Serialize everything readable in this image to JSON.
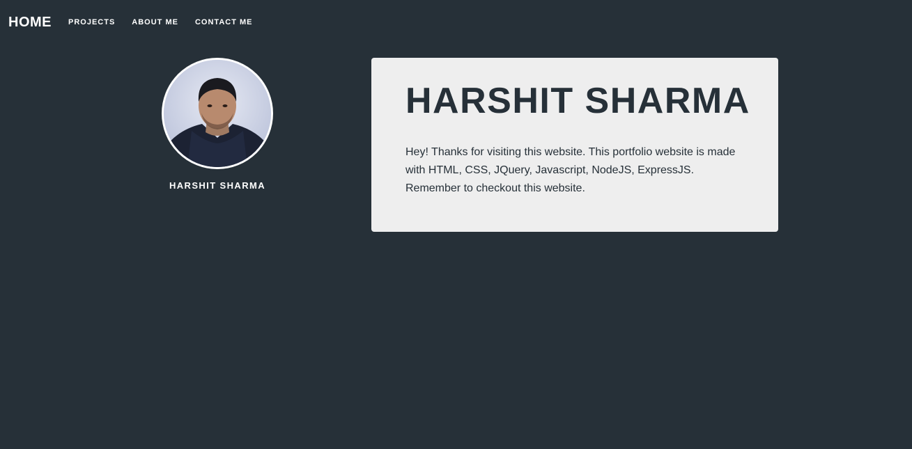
{
  "nav": {
    "brand": "HOME",
    "links": [
      "PROJECTS",
      "ABOUT ME",
      "CONTACT ME"
    ]
  },
  "profile": {
    "name": "HARSHIT SHARMA",
    "avatar_icon": "profile-photo"
  },
  "card": {
    "title": "HARSHIT SHARMA",
    "text": "Hey! Thanks for visiting this website. This portfolio website is made with HTML, CSS, JQuery, Javascript, NodeJS, ExpressJS. Remember to checkout this website."
  },
  "colors": {
    "background": "#263038",
    "card": "#eeeeee",
    "text_light": "#ffffff",
    "text_dark": "#263038"
  }
}
